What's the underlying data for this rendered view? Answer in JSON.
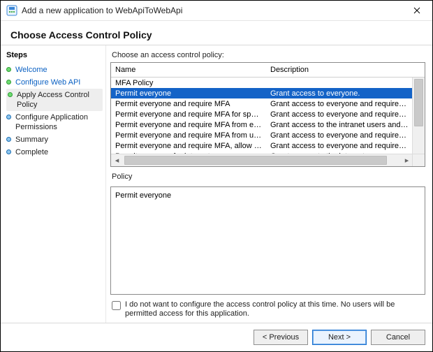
{
  "window": {
    "title": "Add a new application to WebApiToWebApi"
  },
  "page_header": "Choose Access Control Policy",
  "sidebar": {
    "title": "Steps",
    "items": [
      {
        "label": "Welcome",
        "state": "completed"
      },
      {
        "label": "Configure Web API",
        "state": "completed"
      },
      {
        "label": "Apply Access Control Policy",
        "state": "current"
      },
      {
        "label": "Configure Application Permissions",
        "state": "upcoming"
      },
      {
        "label": "Summary",
        "state": "upcoming"
      },
      {
        "label": "Complete",
        "state": "upcoming"
      }
    ]
  },
  "choose_label": "Choose an access control policy:",
  "columns": {
    "name": "Name",
    "description": "Description"
  },
  "rows": [
    {
      "name": "MFA Policy",
      "description": ""
    },
    {
      "name": "Permit everyone",
      "description": "Grant access to everyone.",
      "selected": true
    },
    {
      "name": "Permit everyone and require MFA",
      "description": "Grant access to everyone and require MFA f..."
    },
    {
      "name": "Permit everyone and require MFA for specific group",
      "description": "Grant access to everyone and require MFA f..."
    },
    {
      "name": "Permit everyone and require MFA from extranet access",
      "description": "Grant access to the intranet users and requir..."
    },
    {
      "name": "Permit everyone and require MFA from unauthenticated ...",
      "description": "Grant access to everyone and require MFA f..."
    },
    {
      "name": "Permit everyone and require MFA, allow automatic devi...",
      "description": "Grant access to everyone and require MFA f..."
    },
    {
      "name": "Permit everyone for intranet access",
      "description": "Grant access to the intranet users."
    }
  ],
  "policy_label": "Policy",
  "policy_text": "Permit everyone",
  "skip": {
    "checked": false,
    "text": "I do not want to configure the access control policy at this time.  No users will be permitted access for this application."
  },
  "buttons": {
    "previous": "< Previous",
    "next": "Next >",
    "cancel": "Cancel"
  }
}
